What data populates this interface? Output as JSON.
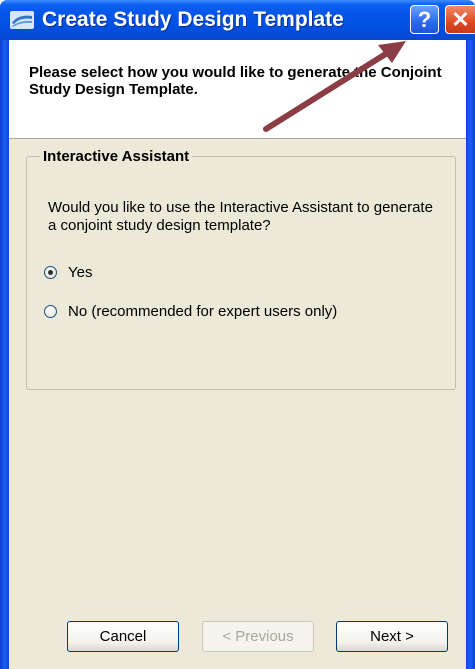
{
  "window": {
    "title": "Create Study Design Template",
    "help_button_label": "?",
    "close_button_label": "✕"
  },
  "header": {
    "instruction": "Please select how you would like to generate the Conjoint Study Design Template."
  },
  "group": {
    "legend": "Interactive Assistant",
    "question": "Would you like to use the Interactive Assistant to generate a conjoint study design template?",
    "options": [
      {
        "label": "Yes",
        "selected": true
      },
      {
        "label": "No (recommended for expert users only)",
        "selected": false
      }
    ]
  },
  "buttons": {
    "cancel": "Cancel",
    "previous": "< Previous",
    "next": "Next >"
  },
  "colors": {
    "titlebar": "#0454e6",
    "annotation_arrow": "#8a3d45",
    "dialog_background": "#ece9d8"
  },
  "icons": {
    "app_icon": "app-logo-icon",
    "help": "help-icon",
    "close": "close-icon"
  }
}
